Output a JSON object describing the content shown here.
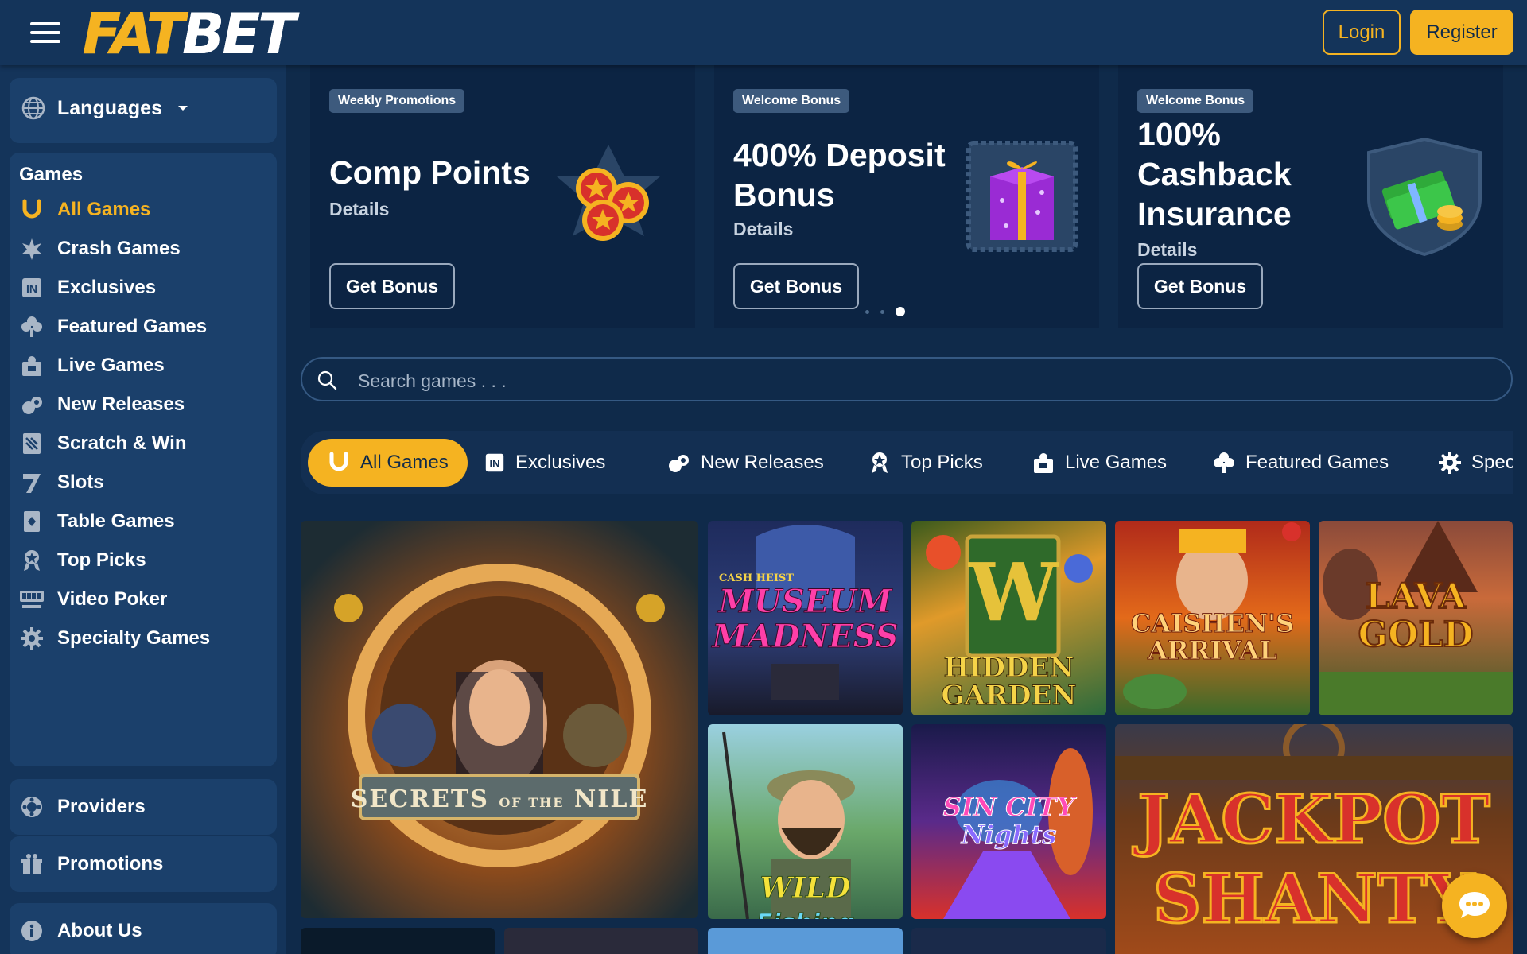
{
  "header": {
    "logo_left": "FAT",
    "logo_right": "BET",
    "login_label": "Login",
    "register_label": "Register"
  },
  "sidebar": {
    "languages_label": "Languages",
    "games_title": "Games",
    "items": [
      {
        "label": "All Games",
        "icon": "horseshoe-icon"
      },
      {
        "label": "Crash Games",
        "icon": "explosion-icon"
      },
      {
        "label": "Exclusives",
        "icon": "exclusive-icon"
      },
      {
        "label": "Featured Games",
        "icon": "clover-icon"
      },
      {
        "label": "Live Games",
        "icon": "live-dealer-icon"
      },
      {
        "label": "New Releases",
        "icon": "new-releases-icon"
      },
      {
        "label": "Scratch & Win",
        "icon": "scratch-card-icon"
      },
      {
        "label": "Slots",
        "icon": "seven-icon"
      },
      {
        "label": "Table Games",
        "icon": "table-card-icon"
      },
      {
        "label": "Top Picks",
        "icon": "award-icon"
      },
      {
        "label": "Video Poker",
        "icon": "video-poker-icon"
      },
      {
        "label": "Specialty Games",
        "icon": "gear-icon"
      }
    ],
    "providers_label": "Providers",
    "promotions_label": "Promotions",
    "about_label": "About Us"
  },
  "promos": [
    {
      "badge": "Weekly Promotions",
      "title": "Comp Points",
      "details": "Details",
      "button": "Get Bonus"
    },
    {
      "badge": "Welcome Bonus",
      "title_line1": "400% Deposit",
      "title_line2": "Bonus",
      "details": "Details",
      "button": "Get Bonus"
    },
    {
      "badge": "Welcome Bonus",
      "title_line1": "100%",
      "title_line2": "Cashback",
      "title_line3": "Insurance",
      "details": "Details",
      "button": "Get Bonus"
    }
  ],
  "carousel": {
    "active_index": 2,
    "count": 3
  },
  "search": {
    "placeholder": "Search games . . ."
  },
  "tabs": [
    {
      "label": "All Games",
      "icon": "horseshoe-icon"
    },
    {
      "label": "Exclusives",
      "icon": "exclusive-icon"
    },
    {
      "label": "New Releases",
      "icon": "new-releases-icon"
    },
    {
      "label": "Top Picks",
      "icon": "award-icon"
    },
    {
      "label": "Live Games",
      "icon": "live-dealer-icon"
    },
    {
      "label": "Featured Games",
      "icon": "clover-icon"
    },
    {
      "label": "Spec",
      "icon": "gear-icon"
    }
  ],
  "games": [
    {
      "title": "SECRETS OF THE NILE",
      "title_main": "SECRETS",
      "title_of": "OF THE",
      "title_end": "NILE"
    },
    {
      "title_top": "CASH HEIST",
      "title_line1": "MUSEUM",
      "title_line2": "MADNESS"
    },
    {
      "title_line1": "HIDDEN",
      "title_line2": "GARDEN"
    },
    {
      "title_line1": "CAISHEN'S",
      "title_line2": "ARRIVAL"
    },
    {
      "title_line1": "LAVA",
      "title_line2": "GOLD"
    },
    {
      "title_line1": "WILD",
      "title_line2": "Fishing"
    },
    {
      "title_line1": "SIN CITY",
      "title_line2": "Nights"
    },
    {
      "title_line1": "JACKPOT",
      "title_line2": "SHANTY"
    }
  ],
  "colors": {
    "accent": "#f5b321",
    "header_bg": "#14345a",
    "page_bg": "#0f2a4a"
  }
}
